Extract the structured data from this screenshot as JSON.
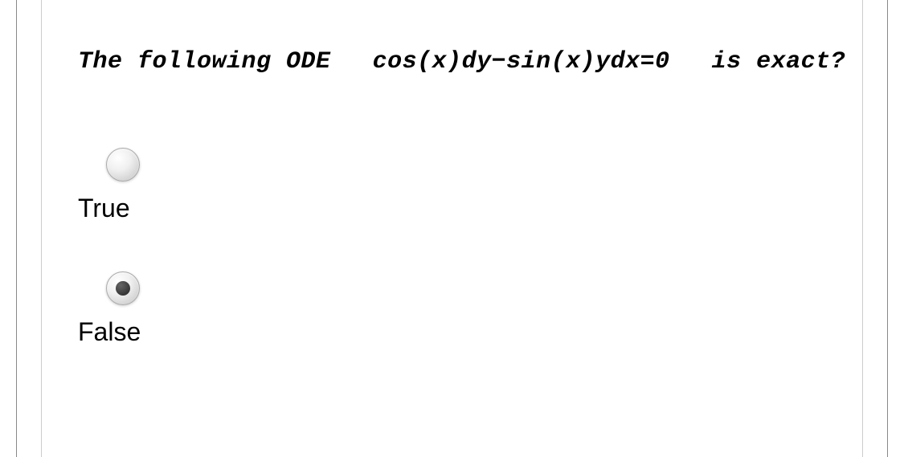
{
  "question": {
    "part1": "The following ODE",
    "part2": "cos(x)dy−sin(x)ydx=0",
    "part3": "is exact?"
  },
  "options": [
    {
      "label": "True",
      "selected": false
    },
    {
      "label": "False",
      "selected": true
    }
  ]
}
